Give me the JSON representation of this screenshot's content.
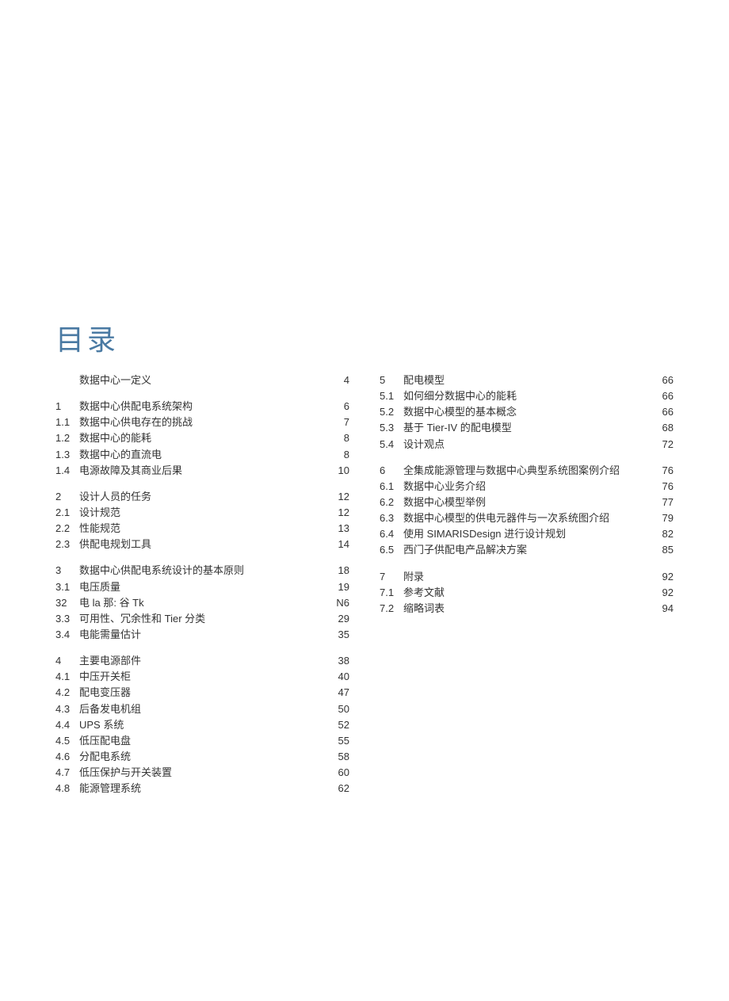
{
  "title": "目录",
  "left": [
    {
      "num": "",
      "text": "数据中心一定义",
      "page": "4"
    },
    {
      "spacer": true
    },
    {
      "num": "1",
      "text": "数据中心供配电系统架构",
      "page": "6"
    },
    {
      "num": "1.1",
      "text": "数据中心供电存在的挑战",
      "page": "7"
    },
    {
      "num": "1.2",
      "text": "数据中心的能耗",
      "page": "8"
    },
    {
      "num": "1.3",
      "text": "数据中心的直流电",
      "page": "8"
    },
    {
      "num": "1.4",
      "text": "电源故障及其商业后果",
      "page": "10"
    },
    {
      "spacer": true
    },
    {
      "num": "2",
      "text": "设计人员的任务",
      "page": "12"
    },
    {
      "num": "2.1",
      "text": "设计规范",
      "page": "12"
    },
    {
      "num": "2.2",
      "text": "性能规范",
      "page": "13"
    },
    {
      "num": "2.3",
      "text": "供配电规划工具",
      "page": "14"
    },
    {
      "spacer": true
    },
    {
      "num": "3",
      "text": "数据中心供配电系统设计的基本原则",
      "page": "18"
    },
    {
      "num": "3.1",
      "text": "电压质量",
      "page": "19"
    },
    {
      "num": "32",
      "text": "电 la 那: 谷 Tk",
      "page": "N6"
    },
    {
      "num": "3.3",
      "text": "可用性、冗余性和 Tier 分类",
      "page": "29"
    },
    {
      "num": "3.4",
      "text": "电能需量估计",
      "page": "35"
    },
    {
      "spacer": true
    },
    {
      "num": "4",
      "text": "主要电源部件",
      "page": "38"
    },
    {
      "num": "4.1",
      "text": "中压开关柜",
      "page": "40"
    },
    {
      "num": "4.2",
      "text": "配电变压器",
      "page": "47"
    },
    {
      "num": "4.3",
      "text": "后备发电机组",
      "page": "50"
    },
    {
      "num": "4.4",
      "text": "UPS 系统",
      "page": "52"
    },
    {
      "num": "4.5",
      "text": "低压配电盘",
      "page": "55"
    },
    {
      "num": "4.6",
      "text": "分配电系统",
      "page": "58"
    },
    {
      "num": "4.7",
      "text": "低压保护与开关装置",
      "page": "60"
    },
    {
      "num": "4.8",
      "text": "能源管理系统",
      "page": "62"
    }
  ],
  "right": [
    {
      "num": "5",
      "text": "配电模型",
      "page": "66"
    },
    {
      "num": "5.1",
      "text": "如何细分数据中心的能耗",
      "page": "66"
    },
    {
      "num": "5.2",
      "text": "数据中心模型的基本概念",
      "page": "66"
    },
    {
      "num": "5.3",
      "text": "基于 Tier-IV 的配电模型",
      "page": "68"
    },
    {
      "num": "5.4",
      "text": "设计观点",
      "page": "72"
    },
    {
      "spacer": true
    },
    {
      "num": "6",
      "text": "全集成能源管理与数据中心典型系统图案例介绍",
      "page": "76"
    },
    {
      "num": "6.1",
      "text": "数据中心业务介绍",
      "page": "76"
    },
    {
      "num": "6.2",
      "text": "数据中心模型举例",
      "page": "77"
    },
    {
      "num": "6.3",
      "text": "数据中心模型的供电元器件与一次系统图介绍",
      "page": "79"
    },
    {
      "num": "6.4",
      "text": "使用 SIMARISDesign 进行设计规划",
      "page": "82"
    },
    {
      "num": "6.5",
      "text": "西门子供配电产品解决方案",
      "page": "85"
    },
    {
      "spacer": true
    },
    {
      "num": "7",
      "text": "附录",
      "page": "92"
    },
    {
      "num": "7.1",
      "text": "参考文献",
      "page": "92"
    },
    {
      "num": "7.2",
      "text": "缩略词表",
      "page": "94"
    }
  ]
}
